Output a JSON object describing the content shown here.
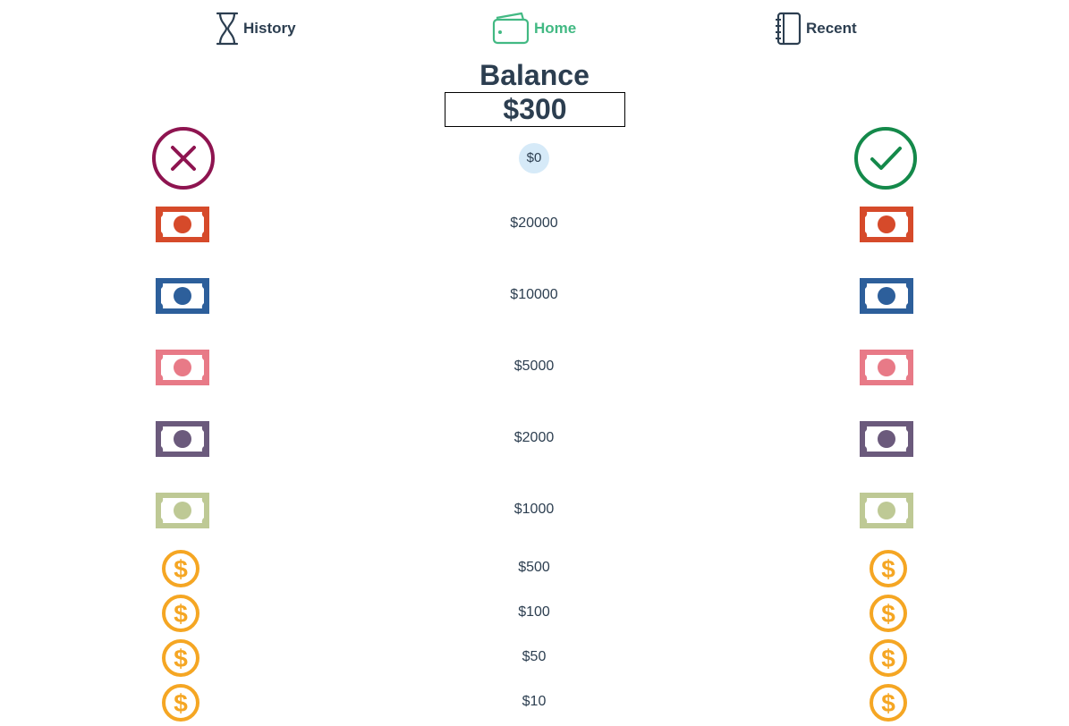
{
  "nav": {
    "history": {
      "label": "History",
      "icon": "hourglass-icon"
    },
    "home": {
      "label": "Home",
      "icon": "wallet-icon",
      "active": true,
      "color": "#42b983"
    },
    "recent": {
      "label": "Recent",
      "icon": "notebook-icon"
    }
  },
  "balance": {
    "title": "Balance",
    "amount": "$300"
  },
  "actions": {
    "cancel": {
      "icon": "x-circle-icon",
      "color": "#8e1450"
    },
    "confirm": {
      "icon": "check-circle-icon",
      "color": "#14894a"
    }
  },
  "selected_amount": "$0",
  "denominations": [
    {
      "label": "$20000",
      "type": "bill",
      "color": "#d64a2a",
      "icon": "banknote-icon"
    },
    {
      "label": "$10000",
      "type": "bill",
      "color": "#2d5f9b",
      "icon": "banknote-icon"
    },
    {
      "label": "$5000",
      "type": "bill",
      "color": "#e87a87",
      "icon": "banknote-icon"
    },
    {
      "label": "$2000",
      "type": "bill",
      "color": "#6b5a7c",
      "icon": "banknote-icon"
    },
    {
      "label": "$1000",
      "type": "bill",
      "color": "#bec995",
      "icon": "banknote-icon"
    },
    {
      "label": "$500",
      "type": "coin",
      "color": "#f5a623",
      "icon": "coin-icon"
    },
    {
      "label": "$100",
      "type": "coin",
      "color": "#f5a623",
      "icon": "coin-icon"
    },
    {
      "label": "$50",
      "type": "coin",
      "color": "#f5a623",
      "icon": "coin-icon"
    },
    {
      "label": "$10",
      "type": "coin",
      "color": "#f5a623",
      "icon": "coin-icon"
    }
  ]
}
